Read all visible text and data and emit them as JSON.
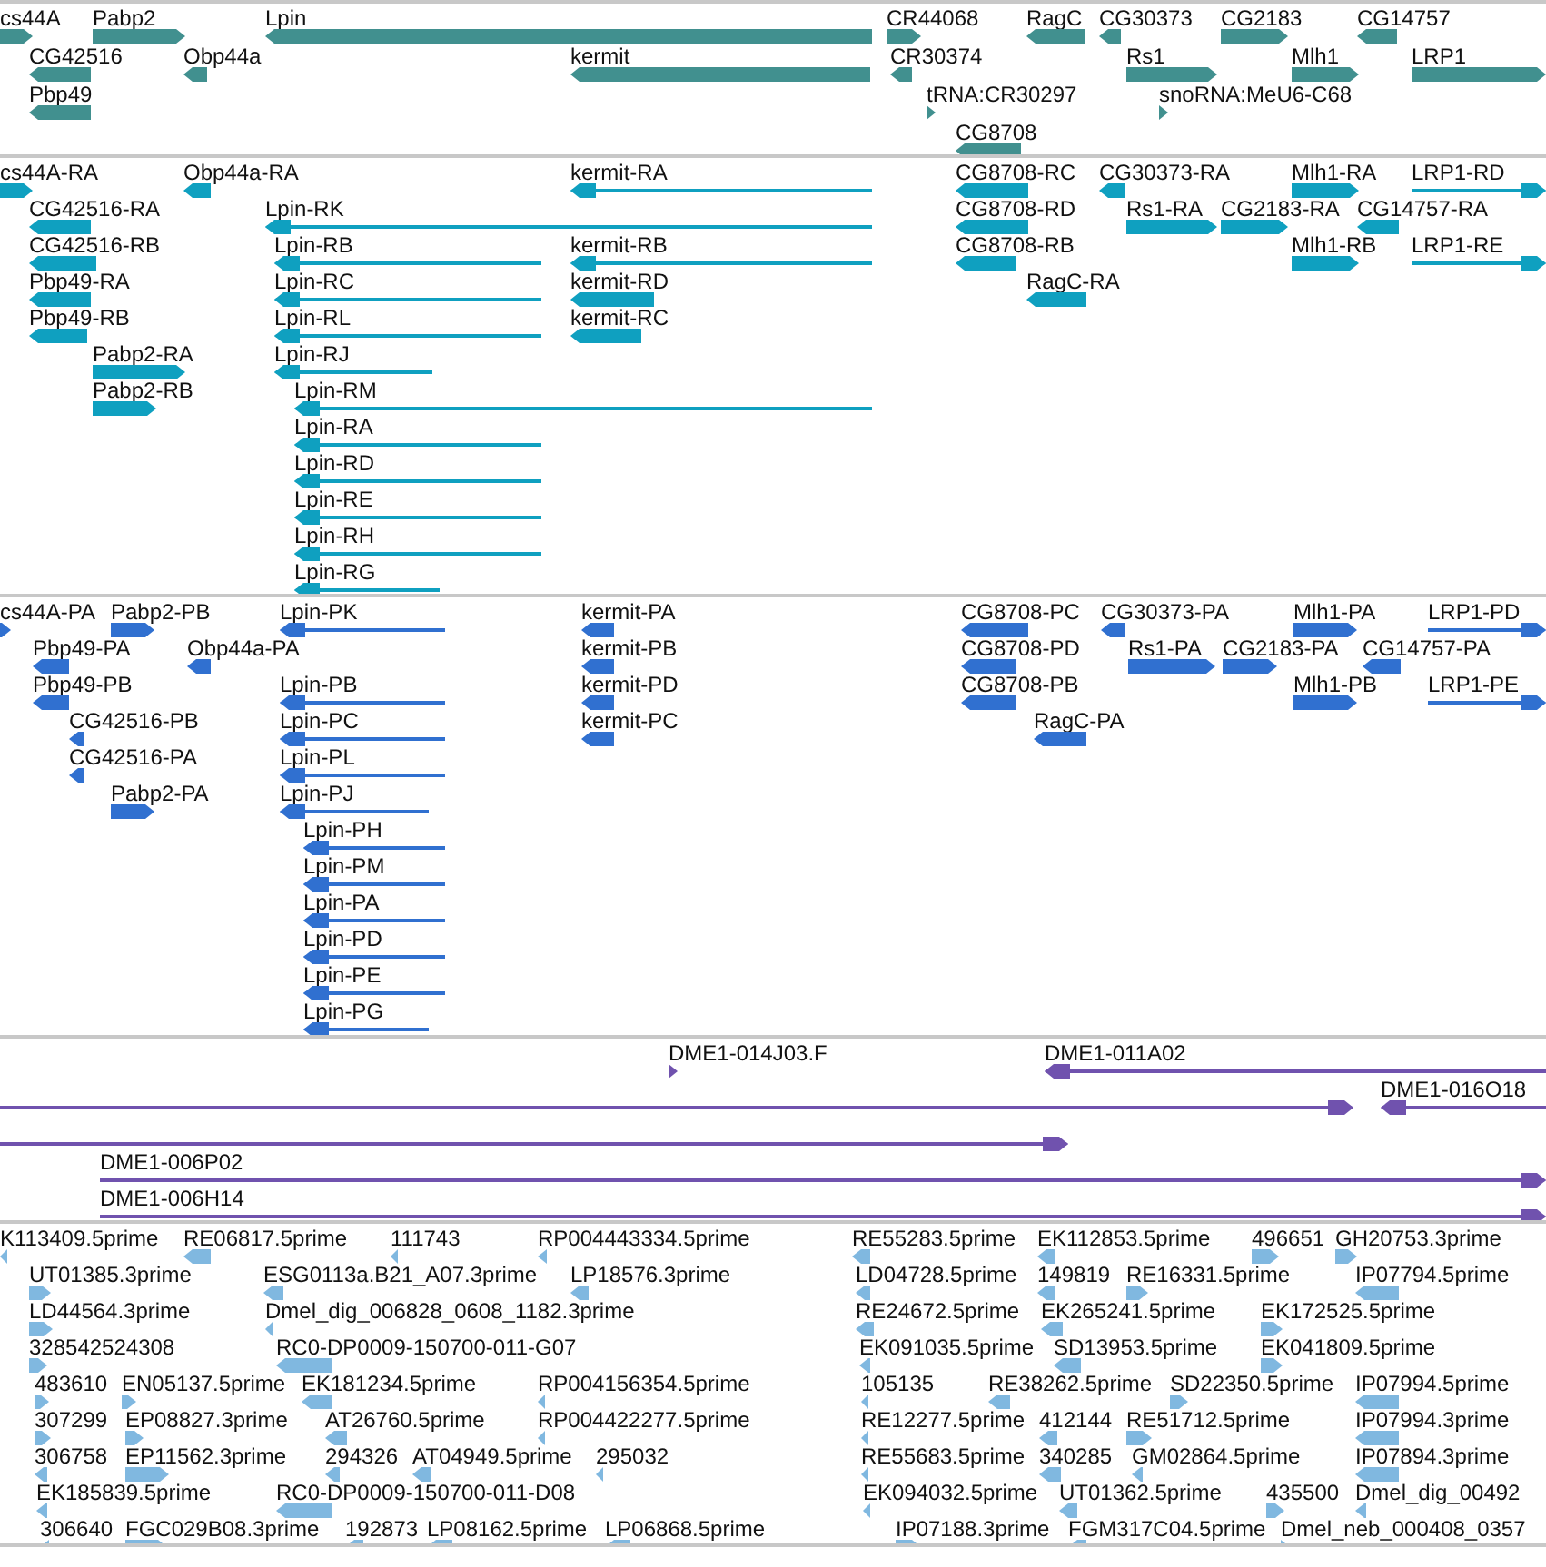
{
  "tracks": [
    {
      "color": "#41908f",
      "features": [
        {
          "label": "cs44A",
          "forward": true
        },
        {
          "label": "Pabp2",
          "forward": true
        },
        {
          "label": "Lpin",
          "forward": false
        },
        {
          "label": "CR44068",
          "forward": true
        },
        {
          "label": "RagC",
          "forward": false
        },
        {
          "label": "CG30373",
          "forward": false
        },
        {
          "label": "CG2183",
          "forward": true
        },
        {
          "label": "CG14757",
          "forward": false
        },
        {
          "label": "CG42516",
          "forward": false
        },
        {
          "label": "Obp44a",
          "forward": false
        },
        {
          "label": "kermit",
          "forward": false
        },
        {
          "label": "CR30374",
          "forward": false
        },
        {
          "label": "Rs1",
          "forward": true
        },
        {
          "label": "Mlh1",
          "forward": true
        },
        {
          "label": "LRP1",
          "forward": true
        },
        {
          "label": "Pbp49",
          "forward": false
        },
        {
          "label": "tRNA:CR30297",
          "forward": true
        },
        {
          "label": "snoRNA:MeU6-C68",
          "forward": true
        },
        {
          "label": "CG8708",
          "forward": false
        }
      ]
    },
    {
      "color": "#0fa0c0",
      "features": [
        {
          "label": "cs44A-RA",
          "forward": true
        },
        {
          "label": "Obp44a-RA",
          "forward": false
        },
        {
          "label": "kermit-RA",
          "forward": false
        },
        {
          "label": "CG8708-RC",
          "forward": false
        },
        {
          "label": "CG30373-RA",
          "forward": false
        },
        {
          "label": "Mlh1-RA",
          "forward": true
        },
        {
          "label": "LRP1-RD",
          "forward": true
        },
        {
          "label": "CG42516-RA",
          "forward": false
        },
        {
          "label": "Lpin-RK",
          "forward": false
        },
        {
          "label": "CG8708-RD",
          "forward": false
        },
        {
          "label": "Rs1-RA",
          "forward": true
        },
        {
          "label": "CG2183-RA",
          "forward": true
        },
        {
          "label": "CG14757-RA",
          "forward": false
        },
        {
          "label": "CG42516-RB",
          "forward": false
        },
        {
          "label": "Lpin-RB",
          "forward": false
        },
        {
          "label": "kermit-RB",
          "forward": false
        },
        {
          "label": "CG8708-RB",
          "forward": false
        },
        {
          "label": "Mlh1-RB",
          "forward": true
        },
        {
          "label": "LRP1-RE",
          "forward": true
        },
        {
          "label": "Pbp49-RA",
          "forward": false
        },
        {
          "label": "Lpin-RC",
          "forward": false
        },
        {
          "label": "kermit-RD",
          "forward": false
        },
        {
          "label": "RagC-RA",
          "forward": false
        },
        {
          "label": "Pbp49-RB",
          "forward": false
        },
        {
          "label": "Lpin-RL",
          "forward": false
        },
        {
          "label": "kermit-RC",
          "forward": false
        },
        {
          "label": "Pabp2-RA",
          "forward": true
        },
        {
          "label": "Lpin-RJ",
          "forward": false
        },
        {
          "label": "Pabp2-RB",
          "forward": true
        },
        {
          "label": "Lpin-RM",
          "forward": false
        },
        {
          "label": "Lpin-RA",
          "forward": false
        },
        {
          "label": "Lpin-RD",
          "forward": false
        },
        {
          "label": "Lpin-RE",
          "forward": false
        },
        {
          "label": "Lpin-RH",
          "forward": false
        },
        {
          "label": "Lpin-RG",
          "forward": false
        }
      ]
    },
    {
      "color": "#3070d0",
      "features": [
        {
          "label": "cs44A-PA",
          "forward": true
        },
        {
          "label": "Pabp2-PB",
          "forward": true
        },
        {
          "label": "Lpin-PK",
          "forward": false
        },
        {
          "label": "kermit-PA",
          "forward": false
        },
        {
          "label": "CG8708-PC",
          "forward": false
        },
        {
          "label": "CG30373-PA",
          "forward": false
        },
        {
          "label": "Mlh1-PA",
          "forward": true
        },
        {
          "label": "LRP1-PD",
          "forward": true
        },
        {
          "label": "Pbp49-PA",
          "forward": false
        },
        {
          "label": "Obp44a-PA",
          "forward": false
        },
        {
          "label": "kermit-PB",
          "forward": false
        },
        {
          "label": "CG8708-PD",
          "forward": false
        },
        {
          "label": "Rs1-PA",
          "forward": true
        },
        {
          "label": "CG2183-PA",
          "forward": true
        },
        {
          "label": "CG14757-PA",
          "forward": false
        },
        {
          "label": "Pbp49-PB",
          "forward": false
        },
        {
          "label": "Lpin-PB",
          "forward": false
        },
        {
          "label": "kermit-PD",
          "forward": false
        },
        {
          "label": "CG8708-PB",
          "forward": false
        },
        {
          "label": "Mlh1-PB",
          "forward": true
        },
        {
          "label": "LRP1-PE",
          "forward": true
        },
        {
          "label": "CG42516-PB",
          "forward": false
        },
        {
          "label": "Lpin-PC",
          "forward": false
        },
        {
          "label": "kermit-PC",
          "forward": false
        },
        {
          "label": "RagC-PA",
          "forward": false
        },
        {
          "label": "CG42516-PA",
          "forward": false
        },
        {
          "label": "Lpin-PL",
          "forward": false
        },
        {
          "label": "Pabp2-PA",
          "forward": true
        },
        {
          "label": "Lpin-PJ",
          "forward": false
        },
        {
          "label": "Lpin-PH",
          "forward": false
        },
        {
          "label": "Lpin-PM",
          "forward": false
        },
        {
          "label": "Lpin-PA",
          "forward": false
        },
        {
          "label": "Lpin-PD",
          "forward": false
        },
        {
          "label": "Lpin-PE",
          "forward": false
        },
        {
          "label": "Lpin-PG",
          "forward": false
        }
      ]
    },
    {
      "color": "#7052ae",
      "features": [
        {
          "label": "DME1-014J03.F",
          "forward": true
        },
        {
          "label": "DME1-011A02",
          "forward": false
        },
        {
          "forward": true
        },
        {
          "label": "DME1-016O18",
          "forward": false
        },
        {
          "forward": true
        },
        {
          "label": "DME1-006P02",
          "forward": true
        },
        {
          "label": "DME1-006H14",
          "forward": true
        }
      ]
    },
    {
      "color": "#80b8e0",
      "features": [
        {
          "label": "K113409.5prime",
          "forward": false
        },
        {
          "label": "RE06817.5prime",
          "forward": false
        },
        {
          "label": "111743",
          "forward": false
        },
        {
          "label": "RP004443334.5prime",
          "forward": false
        },
        {
          "label": "RE55283.5prime",
          "forward": false
        },
        {
          "label": "EK112853.5prime",
          "forward": false
        },
        {
          "label": "496651",
          "forward": true
        },
        {
          "label": "GH20753.3prime",
          "forward": true
        },
        {
          "label": "UT01385.3prime",
          "forward": true
        },
        {
          "label": "ESG0113a.B21_A07.3prime",
          "forward": false
        },
        {
          "label": "LP18576.3prime",
          "forward": false
        },
        {
          "label": "LD04728.5prime",
          "forward": false
        },
        {
          "label": "149819",
          "forward": false
        },
        {
          "label": "RE16331.5prime",
          "forward": true
        },
        {
          "label": "IP07794.5prime",
          "forward": false
        },
        {
          "label": "LD44564.3prime",
          "forward": true
        },
        {
          "label": "Dmel_dig_006828_0608_1182.3prime",
          "forward": false
        },
        {
          "label": "RE24672.5prime",
          "forward": false
        },
        {
          "label": "EK265241.5prime",
          "forward": false
        },
        {
          "label": "EK172525.5prime",
          "forward": true
        },
        {
          "label": "328542524308",
          "forward": true
        },
        {
          "label": "RC0-DP0009-150700-011-G07",
          "forward": false
        },
        {
          "label": "EK091035.5prime",
          "forward": false
        },
        {
          "label": "SD13953.5prime",
          "forward": false
        },
        {
          "label": "EK041809.5prime",
          "forward": true
        },
        {
          "label": "483610",
          "forward": true
        },
        {
          "label": "EN05137.5prime",
          "forward": true
        },
        {
          "label": "EK181234.5prime",
          "forward": false
        },
        {
          "label": "RP004156354.5prime",
          "forward": false
        },
        {
          "label": "105135",
          "forward": false
        },
        {
          "label": "RE38262.5prime",
          "forward": false
        },
        {
          "label": "SD22350.5prime",
          "forward": true
        },
        {
          "label": "IP07994.5prime",
          "forward": false
        },
        {
          "label": "307299",
          "forward": true
        },
        {
          "label": "EP08827.3prime",
          "forward": true
        },
        {
          "label": "AT26760.5prime",
          "forward": false
        },
        {
          "label": "RP004422277.5prime",
          "forward": false
        },
        {
          "label": "RE12277.5prime",
          "forward": false
        },
        {
          "label": "412144",
          "forward": false
        },
        {
          "label": "RE51712.5prime",
          "forward": true
        },
        {
          "label": "IP07994.3prime",
          "forward": false
        },
        {
          "label": "306758",
          "forward": false
        },
        {
          "label": "EP11562.3prime",
          "forward": true
        },
        {
          "label": "294326",
          "forward": false
        },
        {
          "label": "AT04949.5prime",
          "forward": false
        },
        {
          "label": "295032",
          "forward": false
        },
        {
          "label": "RE55683.5prime",
          "forward": false
        },
        {
          "label": "340285",
          "forward": false
        },
        {
          "label": "GM02864.5prime",
          "forward": false
        },
        {
          "label": "IP07894.3prime",
          "forward": false
        },
        {
          "label": "EK185839.5prime",
          "forward": false
        },
        {
          "label": "RC0-DP0009-150700-011-D08",
          "forward": false
        },
        {
          "label": "EK094032.5prime",
          "forward": false
        },
        {
          "label": "UT01362.5prime",
          "forward": false
        },
        {
          "label": "435500",
          "forward": true
        },
        {
          "label": "Dmel_dig_00492",
          "forward": false
        },
        {
          "label": "306640",
          "forward": false
        },
        {
          "label": "FGC029B08.3prime",
          "forward": true
        },
        {
          "label": "192873",
          "forward": false
        },
        {
          "label": "LP08162.5prime",
          "forward": false
        },
        {
          "label": "LP06868.5prime",
          "forward": false
        },
        {
          "label": "IP07188.3prime",
          "forward": true
        },
        {
          "label": "FGM317C04.5prime",
          "forward": false
        },
        {
          "label": "Dmel_neb_000408_0357",
          "forward": true
        }
      ]
    }
  ]
}
